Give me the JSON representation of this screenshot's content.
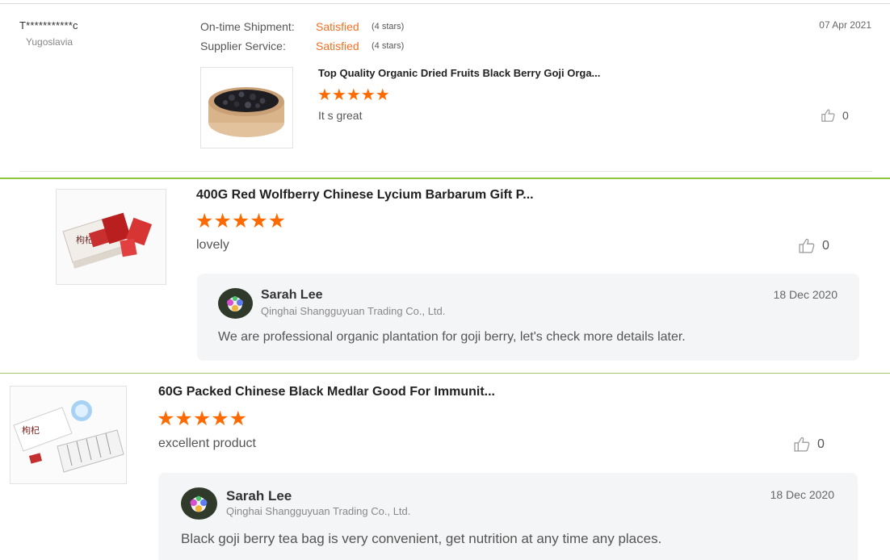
{
  "review1": {
    "user": "T***********c",
    "country": "Yugoslavia",
    "date": "07 Apr 2021",
    "metrics": [
      {
        "label": "On-time Shipment:",
        "value": "Satisfied",
        "note": "(4 stars)"
      },
      {
        "label": "Supplier Service:",
        "value": "Satisfied",
        "note": "(4 stars)"
      }
    ],
    "product_title": "Top Quality Organic Dried Fruits Black Berry Goji Orga...",
    "stars": "★★★★★",
    "comment": "It s great",
    "likes": "0"
  },
  "review2": {
    "product_title": "400G Red Wolfberry Chinese Lycium Barbarum Gift P...",
    "stars": "★★★★★",
    "comment": "lovely",
    "likes": "0",
    "reply": {
      "name": "Sarah Lee",
      "company": "Qinghai Shangguyuan Trading Co., Ltd.",
      "date": "18 Dec 2020",
      "text": "We are professional organic plantation for goji berry, let's check more details later."
    }
  },
  "review3": {
    "product_title": "60G Packed Chinese Black Medlar Good For Immunit...",
    "stars": "★★★★★",
    "comment": "excellent product",
    "likes": "0",
    "reply": {
      "name": "Sarah Lee",
      "company": "Qinghai Shangguyuan Trading Co., Ltd.",
      "date": "18 Dec 2020",
      "text": "Black goji berry tea bag is very convenient, get nutrition at any time any places."
    }
  },
  "colors": {
    "accent": "#ff6a00",
    "satisfied": "#f26f21",
    "divider_green": "#8cc63f"
  },
  "icons": {
    "like": "thumbs-up-icon"
  }
}
